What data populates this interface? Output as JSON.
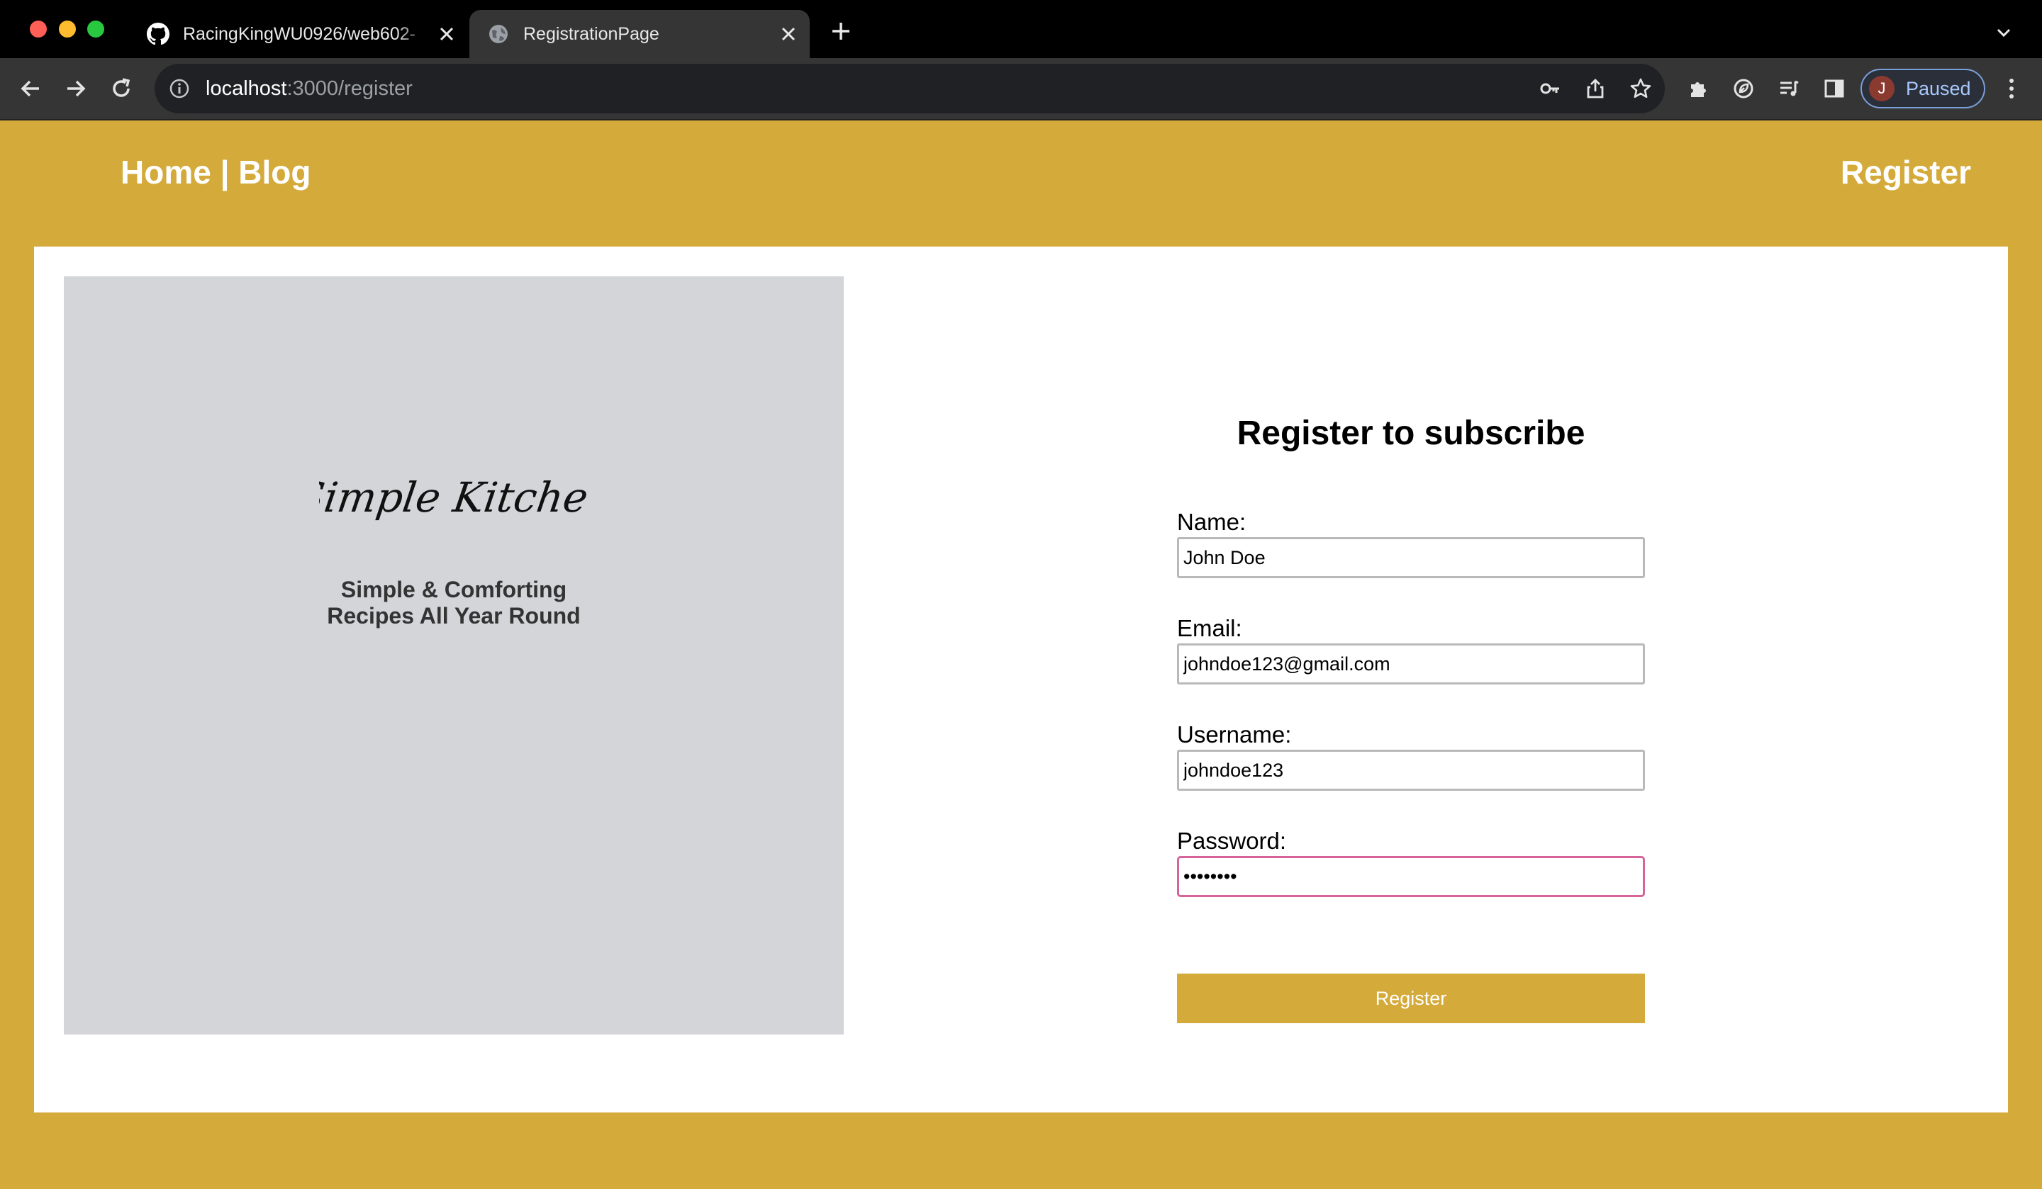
{
  "browser": {
    "tabs": [
      {
        "title": "RacingKingWU0926/web602-",
        "icon": "github-icon",
        "active": false
      },
      {
        "title": "RegistrationPage",
        "icon": "globe-icon",
        "active": true
      }
    ],
    "url_host": "localhost",
    "url_rest": ":3000/register",
    "profile": {
      "initial": "J",
      "label": "Paused"
    }
  },
  "header": {
    "nav_left": "Home | Blog",
    "nav_right": "Register"
  },
  "hero": {
    "logo_text": "Simple Kitchen",
    "tagline_line1": "Simple & Comforting",
    "tagline_line2": "Recipes All Year Round"
  },
  "form": {
    "title": "Register to subscribe",
    "name_label": "Name:",
    "name_value": "John Doe",
    "email_label": "Email:",
    "email_value": "johndoe123@gmail.com",
    "username_label": "Username:",
    "username_value": "johndoe123",
    "password_label": "Password:",
    "password_value": "password",
    "submit_label": "Register"
  },
  "colors": {
    "brand_gold": "#d4aa3a",
    "hero_gray": "#d4d5d9",
    "focus_pink": "#d6649a"
  }
}
